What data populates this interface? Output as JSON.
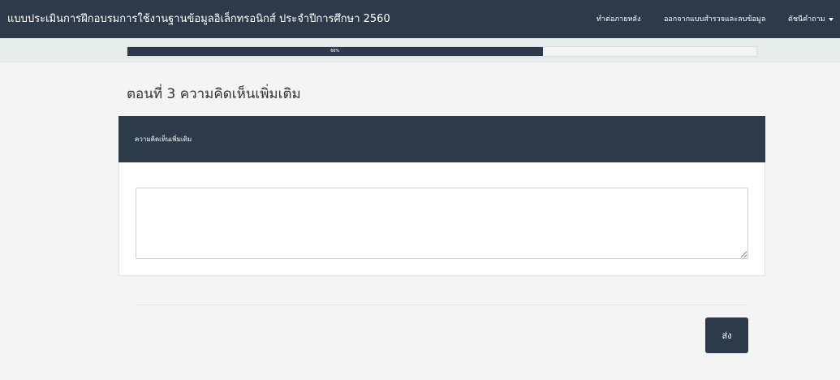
{
  "header": {
    "title": "แบบประเมินการฝึกอบรมการใช้งานฐานข้อมูลอิเล็กทรอนิกส์ ประจำปีการศึกษา 2560",
    "nav": {
      "later_label": "ทำต่อภายหลัง",
      "exit_label": "ออกจากแบบสำรวจและลบข้อมูล",
      "index_label": "ดัชนีคำถาม"
    }
  },
  "progress": {
    "label": "66%",
    "percent": 66
  },
  "section": {
    "title": "ตอนที่ 3 ความคิดเห็นเพิ่มเติม"
  },
  "question": {
    "heading": "ความคิดเห็นเพิ่มเติม",
    "answer_value": ""
  },
  "actions": {
    "submit_label": "ส่ง"
  },
  "colors": {
    "dark": "#2c3a4a",
    "background": "#f4f4f4",
    "progress_strip": "#e6ecea"
  }
}
